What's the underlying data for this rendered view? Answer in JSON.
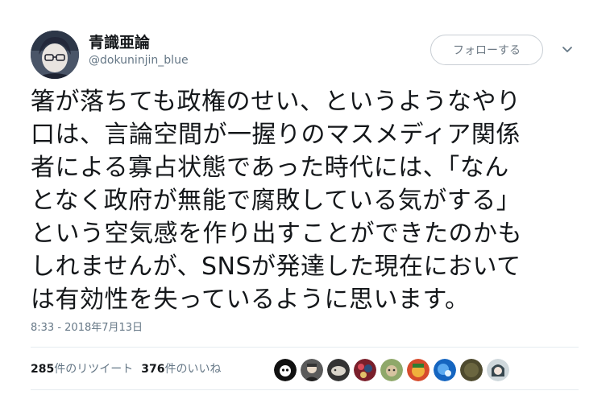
{
  "user": {
    "display_name": "青識亜論",
    "username": "@dokuninjin_blue"
  },
  "follow_label": "フォローする",
  "tweet_lines": [
    "箸が落ちても政権のせい、というようなやり",
    "口は、言論空間が一握りのマスメディア関係",
    "者による寡占状態であった時代には、「なん",
    "となく政府が無能で腐敗している気がする」",
    "という空気感を作り出すことができたのかも",
    "しれませんが、SNSが発達した現在において",
    "は有効性を失っているように思います。"
  ],
  "timestamp": "8:33 - 2018年7月13日",
  "stats": {
    "retweets_count": "285",
    "retweets_label": "件のリツイート",
    "likes_count": "376",
    "likes_label": "件のいいね"
  },
  "liker_avatars": [
    "liker-1",
    "liker-2",
    "liker-3",
    "liker-4",
    "liker-5",
    "liker-6",
    "liker-7",
    "liker-8",
    "liker-9"
  ],
  "colors": {
    "text": "#14171a",
    "muted": "#657786",
    "border": "#e6ecf0"
  }
}
